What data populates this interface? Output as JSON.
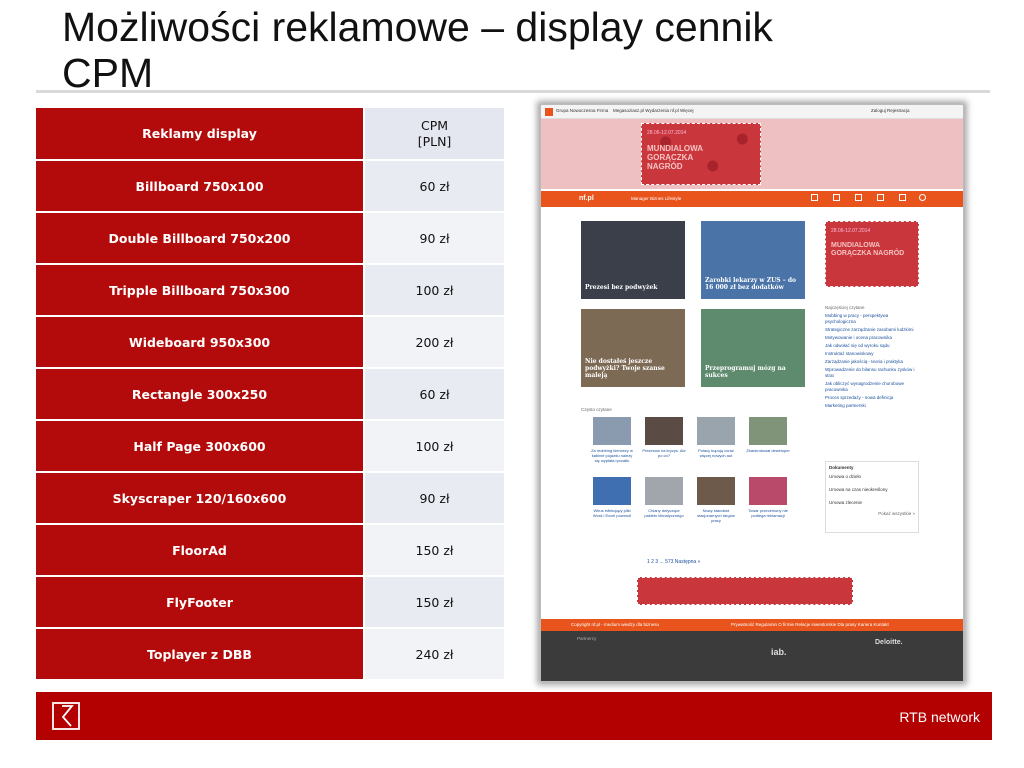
{
  "slide": {
    "title_line1": "Możliwości reklamowe – display cennik",
    "title_line2": "CPM"
  },
  "table": {
    "header": {
      "name": "Reklamy display",
      "price_line1": "CPM",
      "price_line2": "[PLN]"
    },
    "rows": [
      {
        "name": "Billboard 750x100",
        "price": "60 zł"
      },
      {
        "name": "Double Billboard 750x200",
        "price": "90 zł"
      },
      {
        "name": "Tripple Billboard 750x300",
        "price": "100 zł"
      },
      {
        "name": "Wideboard 950x300",
        "price": "200 zł"
      },
      {
        "name": "Rectangle 300x250",
        "price": "60 zł"
      },
      {
        "name": "Half Page 300x600",
        "price": "100 zł"
      },
      {
        "name": "Skyscraper 120/160x600",
        "price": "90 zł"
      },
      {
        "name": "FloorAd",
        "price": "150 zł"
      },
      {
        "name": "FlyFooter",
        "price": "150 zł"
      },
      {
        "name": "Toplayer z DBB",
        "price": "240 zł"
      }
    ]
  },
  "mock": {
    "topbar_left": "Grupa Nowoczesna Firma",
    "topbar_links": "Megasoziasz.pl   Wydarzenia nf.pl   Więcej",
    "topbar_right": "Zaloguj   Rejestracja",
    "banner_date": "28.06-12.07.2014",
    "banner_text": "MUNDIALOWA GORĄCZKA NAGRÓD",
    "nav_brand": "nf.pl",
    "nav_links": "Manager   Biznes   Lifestyle",
    "side_ad_date": "28.06-12.07.2014",
    "side_ad_text": "MUNDIALOWA GORĄCZKA NAGRÓD",
    "tiles": [
      "Prezesi bez podwyżek",
      "Zarobki lekarzy w ZUS – do 16 000 zł bez dodatków",
      "Nie dostałeś jeszcze podwyżki? Twoje szanse maleją",
      "Przeprogramuj mózg na sukces"
    ],
    "list_heading": "Najczęściej czytane",
    "list_items": [
      "Mobbing w pracy - perspektywa psychologiczna",
      "Strategiczne zarządzanie zasobami ludzkimi",
      "Motywowanie i ocena pracownika",
      "Jak odwołać się od wyroku sądu",
      "Instruktaż stanowiskowy",
      "Zarządzanie jakością - teoria i praktyka",
      "Wprowadzenie do bilansu rachunku zysków i strat",
      "Jak obliczyć wynagrodzenie chorobowe pracownika",
      "Proces sprzedaży - nowa definicja",
      "Marketing partnerski"
    ],
    "section_label": "Często czytane",
    "thumb_captions": [
      "Za mobbing kierowcy w kabinie pojazdu należy się wypłata ryczałtu",
      "Prezesów na kryzys. Ale po co?",
      "Polacy kupują coraz więcej nowych aut",
      "Zbankrutował deweloper",
      "Wirus infekujący pliki Word i Excel powrócił",
      "Chiany dotyczące pakietu klimatycznego",
      "Nowy standard stacjonarnych targów pracy",
      "Towar przeceniony nie podlega reklamacji"
    ],
    "docs_heading": "Dokumenty",
    "docs_items": [
      "Umowa o dzieło",
      "Umowa na czas nieokreślony",
      "Umowa zlecenie"
    ],
    "docs_more": "Pokaż wszystkie »",
    "pager": "1   2   3   ...   573   Następna »",
    "footbar_text": "Copyright nf.pl - medium wiedzy dla biznesu",
    "footbar_links": "Prywatność   Regulamin   O firmie   Relacje inwestorskie   Dla prasy   Kariera   Kontakt",
    "partners_label": "Partnerzy",
    "partner_iab": "iab.",
    "partner_deloitte": "Deloitte."
  },
  "footer": {
    "brand": "RTB network"
  },
  "colors": {
    "accent_red": "#b30b0b",
    "price_cell": "#e8ebf2",
    "site_orange": "#e8541b"
  }
}
